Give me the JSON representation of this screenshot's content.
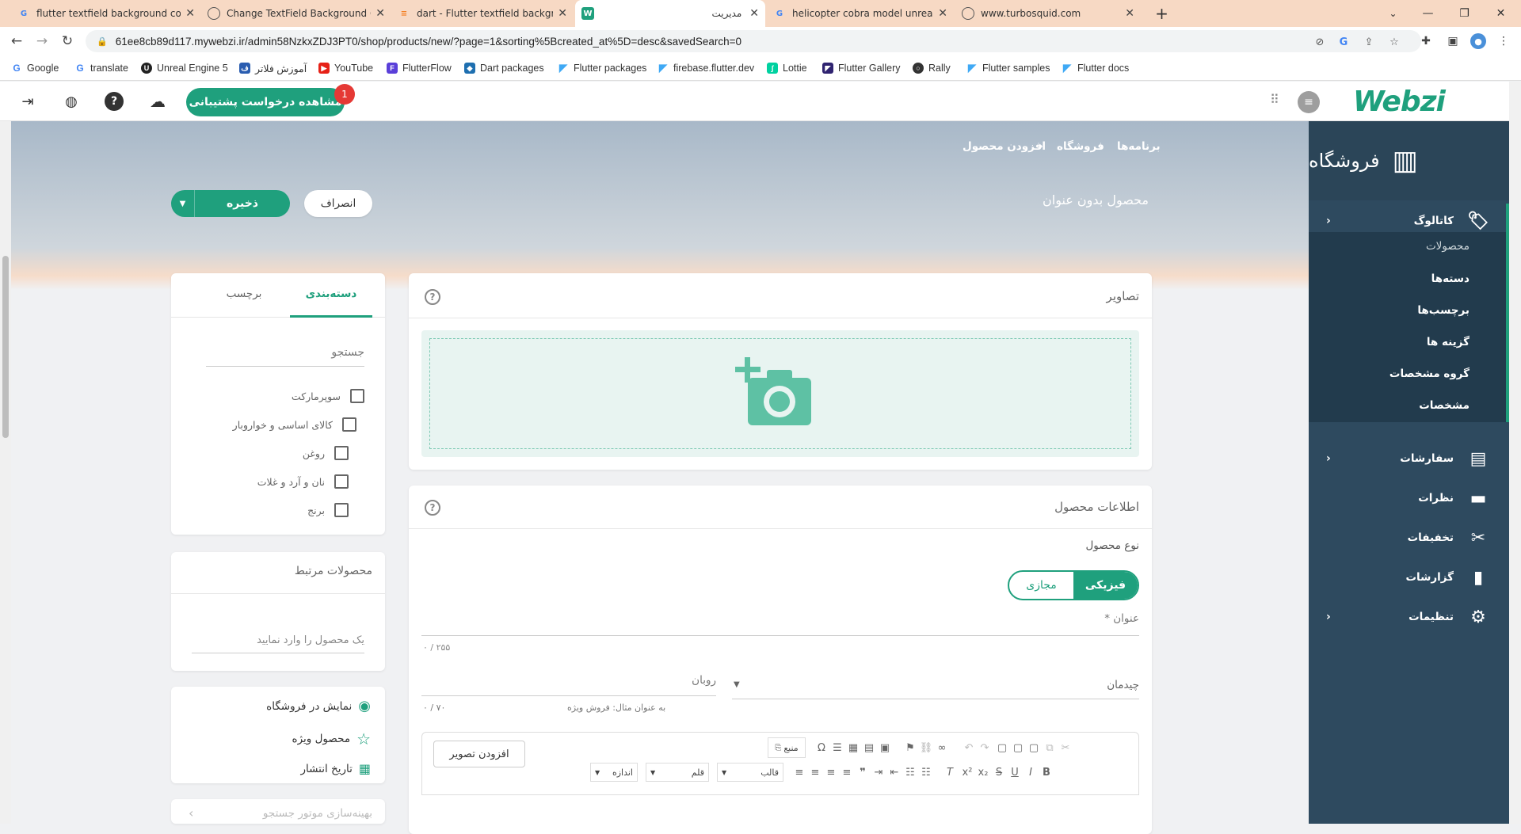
{
  "browser": {
    "tabs": [
      {
        "title": "flutter textfield background colo",
        "icon": "google-icon"
      },
      {
        "title": "Change TextField Background Co",
        "icon": "globe-icon"
      },
      {
        "title": "dart - Flutter textfield backgroun",
        "icon": "stackoverflow-icon"
      },
      {
        "title": "مدیریت",
        "icon": "webzi-icon"
      },
      {
        "title": "helicopter cobra model unreal er",
        "icon": "google-icon"
      },
      {
        "title": "www.turbosquid.com",
        "icon": "globe-icon"
      }
    ],
    "url": "61ee8cb89d117.mywebzi.ir/admin58NzkxZDJ3PT0/shop/products/new/?page=1&sorting%5Bcreated_at%5D=desc&savedSearch=0",
    "bookmarks": [
      "Google",
      "translate",
      "Unreal Engine 5",
      "آموزش فلاتر",
      "YouTube",
      "FlutterFlow",
      "Dart packages",
      "Flutter packages",
      "firebase.flutter.dev",
      "Lottie",
      "Flutter Gallery",
      "Rally",
      "Flutter samples",
      "Flutter docs"
    ]
  },
  "header": {
    "support_button": "مشاهده درخواست پشتیبانی",
    "support_badge": "1",
    "logo": "Webzi"
  },
  "sidebar": {
    "title": "فروشگاه",
    "catalog": "کاتالوگ",
    "catalog_items": [
      "محصولات",
      "دسته‌ها",
      "برچسب‌ها",
      "گزینه ها",
      "گروه مشخصات",
      "مشخصات"
    ],
    "items": [
      "سفارشات",
      "نظرات",
      "تخفیفات",
      "گزارشات",
      "تنظیمات"
    ]
  },
  "breadcrumb": [
    "برنامه‌ها",
    "فروشگاه",
    "افزودن محصول"
  ],
  "page": {
    "title": "محصول بدون عنوان",
    "save_label": "ذخیره",
    "cancel_label": "انصراف"
  },
  "images_card": {
    "title": "تصاویر"
  },
  "info_card": {
    "title": "اطلاعات محصول",
    "product_type_label": "نوع محصول",
    "type_physical": "فیزیکی",
    "type_virtual": "مجازی",
    "title_label": "عنوان *",
    "title_counter": "۰ / ۲۵۵",
    "layout_label": "چیدمان",
    "ribbon_label": "روبان",
    "ribbon_hint": "به عنوان مثال: فروش ویژه",
    "ribbon_counter": "۰ / ۷۰",
    "add_image_button": "افزودن تصویر",
    "editor_source": "منبع",
    "editor_format": "قالب",
    "editor_font": "قلم",
    "editor_size": "اندازه"
  },
  "category_card": {
    "tab_categories": "دسته‌بندی",
    "tab_tags": "برچسب",
    "search_placeholder": "جستجو",
    "options": [
      "سوپرمارکت",
      "کالای اساسی و خواروبار",
      "روغن",
      "نان و آرد و غلات",
      "برنج"
    ]
  },
  "related_card": {
    "title": "محصولات مرتبط",
    "placeholder": "یک محصول را وارد نمایید"
  },
  "visibility_card": {
    "show_in_store": "نمایش در فروشگاه",
    "featured": "محصول ویژه",
    "publish_date": "تاریخ انتشار"
  },
  "seo_card": {
    "title": "بهینه‌سازی موتور جستجو"
  },
  "colors": {
    "accent": "#1fa07d",
    "sidebar": "#2e4a5f",
    "badge": "#e53935"
  }
}
